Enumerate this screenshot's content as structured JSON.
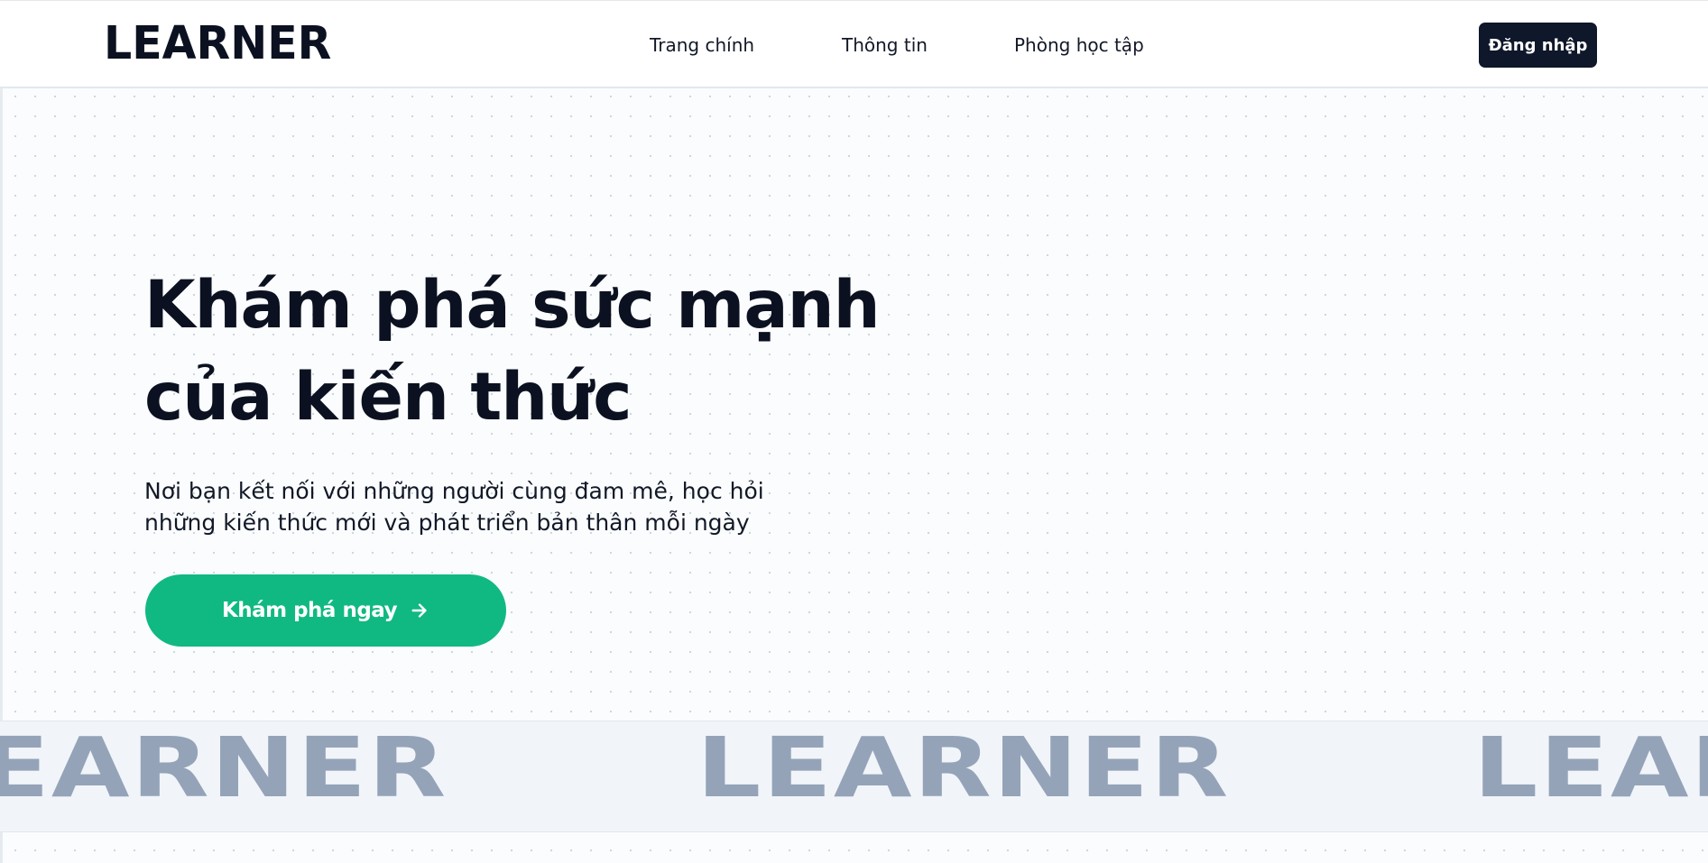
{
  "brand": {
    "logo": "LEARNER"
  },
  "nav": {
    "links": [
      "Trang chính",
      "Thông tin",
      "Phòng học tập"
    ],
    "login_label": "Đăng nhập"
  },
  "hero": {
    "title_line1": "Khám phá sức mạnh",
    "title_line2": "của kiến thức",
    "subtitle_line1": "Nơi bạn kết nối với những người cùng đam mê, học hỏi",
    "subtitle_line2": "những kiến thức mới và phát triển bản thân mỗi ngày",
    "cta_label": "Khám phá ngay",
    "cta_icon": "arrow-right-icon"
  },
  "marquee": {
    "word": "LEARNER"
  },
  "colors": {
    "primary_dark": "#0f172a",
    "accent_green": "#10b981",
    "marquee_text": "#94a3b8",
    "marquee_bg": "#f1f5f9"
  }
}
